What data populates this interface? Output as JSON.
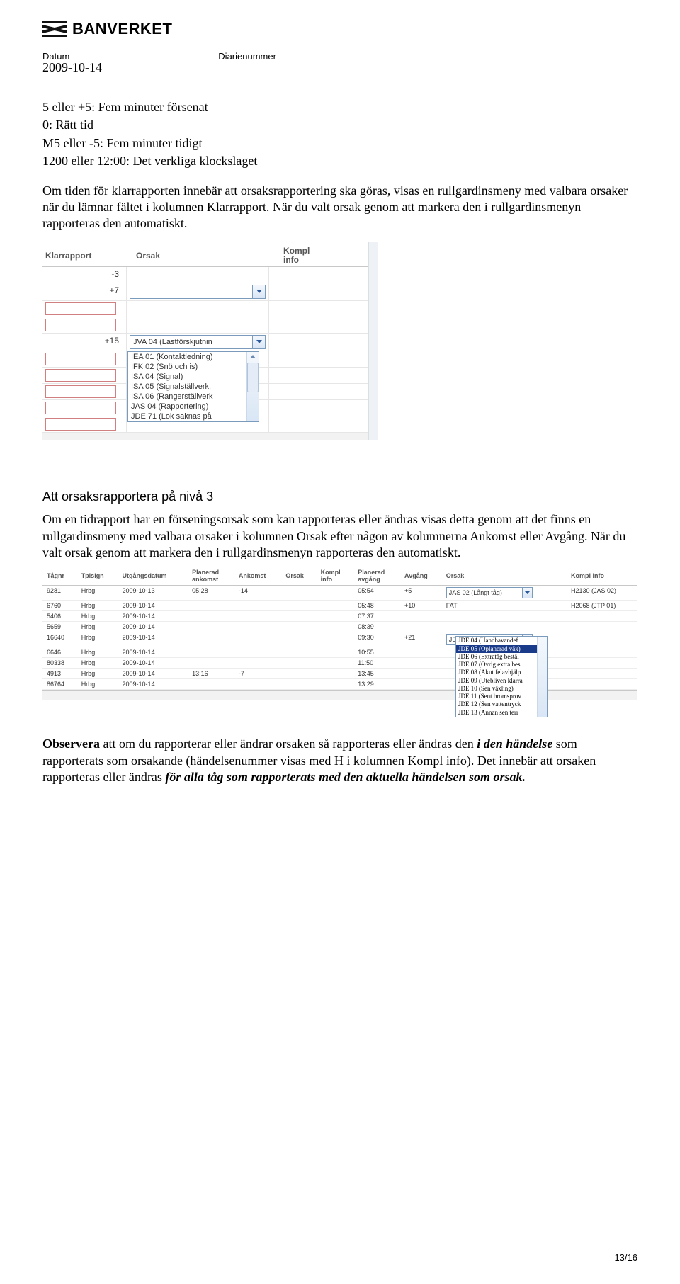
{
  "brand": "BANVERKET",
  "meta": {
    "datum_label": "Datum",
    "diarie_label": "Diarienummer",
    "date": "2009-10-14"
  },
  "intro": {
    "l1": "5 eller +5: Fem minuter försenat",
    "l2": "0: Rätt tid",
    "l3": "M5 eller -5: Fem minuter tidigt",
    "l4": "1200 eller 12:00: Det verkliga klockslaget",
    "para": "Om tiden för klarrapporten innebär att orsaksrapportering ska göras, visas en rullgardinsmeny med valbara orsaker när du lämnar fältet i kolumnen Klarrapport. När du valt orsak genom att markera den i rullgardinsmenyn rapporteras den automatiskt."
  },
  "shot1": {
    "h_klar": "Klarrapport",
    "h_orsak": "Orsak",
    "h_kompl1": "Kompl",
    "h_kompl2": "info",
    "v1": "-3",
    "v2": "+7",
    "v3": "+15",
    "sel3": "JVA 04 (Lastförskjutnin",
    "dd": [
      "IEA 01 (Kontaktledning)",
      "IFK 02 (Snö och is)",
      "ISA 04 (Signal)",
      "ISA 05 (Signalställverk,",
      "ISA 06 (Rangerställverk",
      "JAS 04 (Rapportering)",
      "JDE 71 (Lok saknas på"
    ]
  },
  "section2": {
    "heading": "Att orsaksrapportera på nivå 3",
    "para": "Om en tidrapport har en förseningsorsak som kan rapporteras eller ändras visas detta genom att det finns en rullgardinsmeny med valbara orsaker i kolumnen Orsak efter någon av kolumnerna Ankomst eller Avgång. När du valt orsak genom att markera den i rullgardinsmenyn rapporteras den automatiskt."
  },
  "shot2": {
    "headers": [
      "Tågnr",
      "Tplsign",
      "Utgångsdatum",
      "Planerad\nankomst",
      "Ankomst",
      "Orsak",
      "Kompl\ninfo",
      "Planerad\navgång",
      "Avgång",
      "Orsak",
      "Kompl info"
    ],
    "rows": [
      {
        "tag": "9281",
        "tpl": "Hrbg",
        "ud": "2009-10-13",
        "pa": "05:28",
        "an": "-14",
        "or1": "",
        "ki": "",
        "pg": "05:54",
        "av": "+5",
        "or2_sel": "JAS 02 (Långt tåg)",
        "kinfo": "H2130 (JAS 02)"
      },
      {
        "tag": "6760",
        "tpl": "Hrbg",
        "ud": "2009-10-14",
        "pa": "",
        "an": "",
        "or1": "",
        "ki": "",
        "pg": "05:48",
        "av": "+10",
        "or2": "FAT",
        "kinfo": "H2068 (JTP 01)"
      },
      {
        "tag": "5406",
        "tpl": "Hrbg",
        "ud": "2009-10-14",
        "pa": "",
        "an": "",
        "or1": "",
        "ki": "",
        "pg": "07:37",
        "av": "",
        "or2": "",
        "kinfo": ""
      },
      {
        "tag": "5659",
        "tpl": "Hrbg",
        "ud": "2009-10-14",
        "pa": "",
        "an": "",
        "or1": "",
        "ki": "",
        "pg": "08:39",
        "av": "",
        "or2": "",
        "kinfo": ""
      },
      {
        "tag": "16640",
        "tpl": "Hrbg",
        "ud": "2009-10-14",
        "pa": "",
        "an": "",
        "or1": "",
        "ki": "",
        "pg": "09:30",
        "av": "+21",
        "or2_sel": "JDE 05 (Oplanerad väx",
        "kinfo": ""
      },
      {
        "tag": "6646",
        "tpl": "Hrbg",
        "ud": "2009-10-14",
        "pa": "",
        "an": "",
        "or1": "",
        "ki": "",
        "pg": "10:55",
        "av": "",
        "or2": "",
        "kinfo": ""
      },
      {
        "tag": "80338",
        "tpl": "Hrbg",
        "ud": "2009-10-14",
        "pa": "",
        "an": "",
        "or1": "",
        "ki": "",
        "pg": "11:50",
        "av": "",
        "or2": "",
        "kinfo": ""
      },
      {
        "tag": "4913",
        "tpl": "Hrbg",
        "ud": "2009-10-14",
        "pa": "13:16",
        "an": "-7",
        "or1": "",
        "ki": "",
        "pg": "13:45",
        "av": "",
        "or2": "",
        "kinfo": ""
      },
      {
        "tag": "86764",
        "tpl": "Hrbg",
        "ud": "2009-10-14",
        "pa": "",
        "an": "",
        "or1": "",
        "ki": "",
        "pg": "13:29",
        "av": "",
        "or2": "",
        "kinfo": ""
      }
    ],
    "dd": [
      {
        "t": "JDE 04 (Handhavandef",
        "hl": false
      },
      {
        "t": "JDE 05 (Oplanerad väx)",
        "hl": true
      },
      {
        "t": "JDE 06 (Extratåg bestäl",
        "hl": false
      },
      {
        "t": "JDE 07 (Övrig extra bes",
        "hl": false
      },
      {
        "t": "JDE 08 (Akut felavhjälp",
        "hl": false
      },
      {
        "t": "JDE 09 (Utebliven klarra",
        "hl": false
      },
      {
        "t": "JDE 10 (Sen växling)",
        "hl": false
      },
      {
        "t": "JDE 11 (Sent bromsprov",
        "hl": false
      },
      {
        "t": "JDE 12 (Sen vattentryck",
        "hl": false
      },
      {
        "t": "JDE 13 (Annan sen terr",
        "hl": false
      }
    ]
  },
  "obs": {
    "b1": "Observera",
    "t1": " att om du rapporterar eller ändrar orsaken så rapporteras eller ändras den ",
    "i1": "i den händelse",
    "t2": " som rapporterats som orsakande (händelsenummer visas med H i kolumnen Kompl info). Det innebär att orsaken rapporteras eller ändras ",
    "i2": "för alla tåg som rapporterats med den aktuella händelsen som orsak."
  },
  "page_num": "13/16"
}
